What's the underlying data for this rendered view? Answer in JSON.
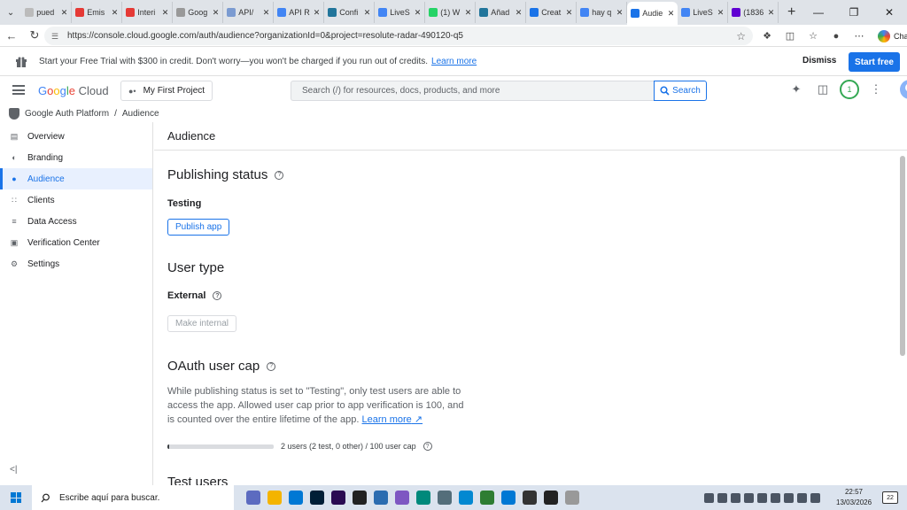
{
  "browser": {
    "tabs": [
      {
        "label": "pued",
        "color": "#bbb"
      },
      {
        "label": "Emis",
        "color": "#e53935"
      },
      {
        "label": "Interi",
        "color": "#e53935"
      },
      {
        "label": "Goog",
        "color": "#999"
      },
      {
        "label": "API/",
        "color": "#7b9bd1"
      },
      {
        "label": "API R",
        "color": "#4285f4"
      },
      {
        "label": "Confi",
        "color": "#21759b"
      },
      {
        "label": "LiveS",
        "color": "#4285f4"
      },
      {
        "label": "(1) W",
        "color": "#25d366"
      },
      {
        "label": "Añad",
        "color": "#21759b"
      },
      {
        "label": "Creat",
        "color": "#1a73e8"
      },
      {
        "label": "hay q",
        "color": "#4285f4"
      },
      {
        "label": "Audie",
        "color": "#1a73e8",
        "active": true
      },
      {
        "label": "LiveS",
        "color": "#4285f4"
      },
      {
        "label": "(1836",
        "color": "#6001d2"
      }
    ],
    "url": "https://console.cloud.google.com/auth/audience?organizationId=0&project=resolute-radar-490120-q5",
    "chat_label": "Chat"
  },
  "banner": {
    "text": "Start your Free Trial with $300 in credit. Don't worry—you won't be charged if you run out of credits.",
    "link": "Learn more",
    "dismiss": "Dismiss",
    "start_free": "Start free"
  },
  "header": {
    "logo_google": "Google",
    "logo_cloud": "Cloud",
    "project": "My First Project",
    "search_placeholder": "Search (/) for resources, docs, products, and more",
    "search_button": "Search",
    "notification_count": "1"
  },
  "breadcrumb": {
    "root": "Google Auth Platform",
    "separator": "/",
    "current": "Audience"
  },
  "sidebar": {
    "items": [
      {
        "label": "Overview",
        "icon": "overview-icon"
      },
      {
        "label": "Branding",
        "icon": "palette-icon"
      },
      {
        "label": "Audience",
        "icon": "person-icon",
        "active": true
      },
      {
        "label": "Clients",
        "icon": "grid-icon"
      },
      {
        "label": "Data Access",
        "icon": "data-access-icon"
      },
      {
        "label": "Verification Center",
        "icon": "verification-icon"
      },
      {
        "label": "Settings",
        "icon": "gear-icon"
      }
    ],
    "collapse": "<|"
  },
  "main": {
    "page_title": "Audience",
    "publishing": {
      "heading": "Publishing status",
      "status": "Testing",
      "button": "Publish app"
    },
    "user_type": {
      "heading": "User type",
      "value": "External",
      "button": "Make internal"
    },
    "cap": {
      "heading": "OAuth user cap",
      "paragraph": "While publishing status is set to \"Testing\", only test users are able to access the app. Allowed user cap prior to app verification is 100, and is counted over the entire lifetime of the app.",
      "link": "Learn more",
      "usage_text": "2 users (2 test, 0 other) / 100 user cap",
      "usage_fraction": 0.02
    },
    "test_users_heading": "Test users"
  },
  "taskbar": {
    "search_placeholder": "Escribe aquí para buscar.",
    "time": "22:57",
    "date": "13/03/2026",
    "notifications": "22",
    "apps": [
      "#5c6bc0",
      "#f4b400",
      "#0078d4",
      "#001e36",
      "#2a0a52",
      "#222",
      "#2b6cb0",
      "#7e57c2",
      "#00897b",
      "#546e7a",
      "#0288d1",
      "#2e7d32",
      "#0078d4",
      "#333",
      "#222",
      "#999"
    ]
  }
}
